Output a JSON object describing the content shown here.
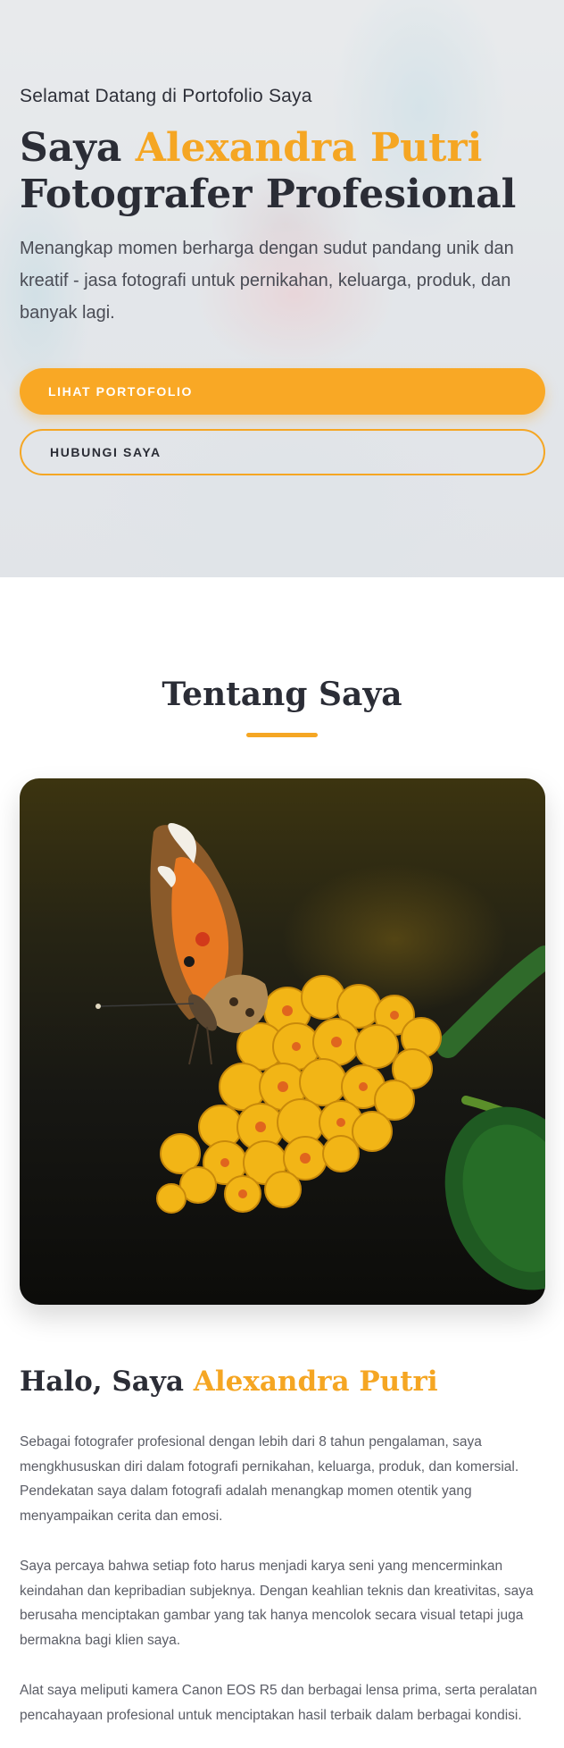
{
  "hero": {
    "welcome": "Selamat Datang di Portofolio Saya",
    "title_prefix": "Saya",
    "title_name": "Alexandra Putri",
    "title_line2": "Fotografer Profesional",
    "description": "Menangkap momen berharga dengan sudut pandang unik dan kreatif - jasa fotografi untuk pernikahan, keluarga, produk, dan banyak lagi.",
    "primary_button": "LIHAT PORTOFOLIO",
    "secondary_button": "HUBUNGI SAYA"
  },
  "about": {
    "section_title": "Tentang Saya",
    "image_alt": "Kupu-kupu di atas bunga kuning",
    "heading_prefix": "Halo, Saya",
    "heading_name": "Alexandra Putri",
    "paragraphs": [
      "Sebagai fotografer profesional dengan lebih dari 8 tahun pengalaman, saya mengkhususkan diri dalam fotografi pernikahan, keluarga, produk, dan komersial. Pendekatan saya dalam fotografi adalah menangkap momen otentik yang menyampaikan cerita dan emosi.",
      "Saya percaya bahwa setiap foto harus menjadi karya seni yang mencerminkan keindahan dan kepribadian subjeknya. Dengan keahlian teknis dan kreativitas, saya berusaha menciptakan gambar yang tak hanya mencolok secara visual tetapi juga bermakna bagi klien saya.",
      "Alat saya meliputi kamera Canon EOS R5 dan berbagai lensa prima, serta peralatan pencahayaan profesional untuk menciptakan hasil terbaik dalam berbagai kondisi."
    ]
  },
  "colors": {
    "accent": "#f5a623",
    "text_dark": "#2b2d36",
    "text_body": "#5b5d66"
  }
}
